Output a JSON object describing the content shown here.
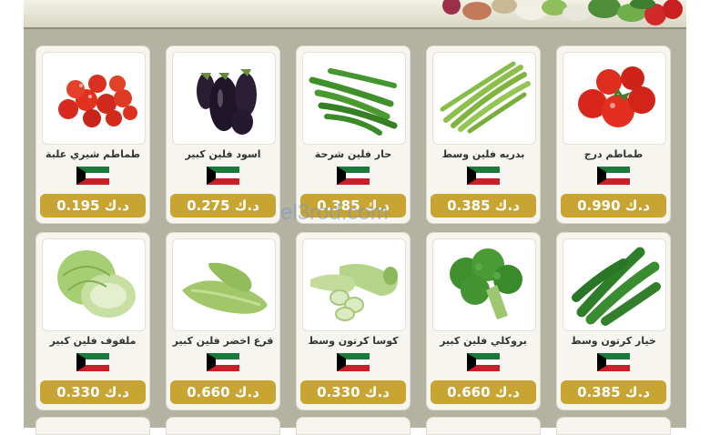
{
  "watermark": "el3rod.com",
  "currency_note": "Prices in Kuwaiti Dinar",
  "products": [
    {
      "name": "طماطم شيري علبة",
      "price": "0.195 د.ك",
      "icon": "cherry-tomatoes"
    },
    {
      "name": "اسود فلين كبير",
      "price": "0.275 د.ك",
      "icon": "eggplant"
    },
    {
      "name": "حار فلين شرحة",
      "price": "0.385 د.ك",
      "icon": "green-chili"
    },
    {
      "name": "بدريه فلين وسط",
      "price": "0.385 د.ك",
      "icon": "green-beans"
    },
    {
      "name": "طماطم درج",
      "price": "0.990 د.ك",
      "icon": "tomatoes"
    },
    {
      "name": "ملفوف فلين كبير",
      "price": "0.330 د.ك",
      "icon": "cabbage"
    },
    {
      "name": "قرع اخضر فلين كبير",
      "price": "0.660 د.ك",
      "icon": "green-squash"
    },
    {
      "name": "كوسا كرتون وسط",
      "price": "0.330 د.ك",
      "icon": "zucchini"
    },
    {
      "name": "بروكلي فلين كبير",
      "price": "0.660 د.ك",
      "icon": "broccoli"
    },
    {
      "name": "خيار كرتون وسط",
      "price": "0.385 د.ك",
      "icon": "cucumber"
    }
  ]
}
